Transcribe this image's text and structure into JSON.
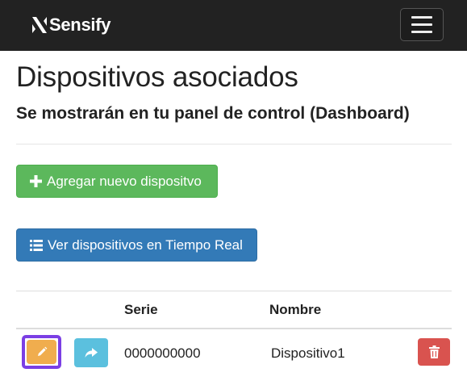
{
  "navbar": {
    "brand_name": "Sensify",
    "menu_toggle_icon": "hamburger-icon"
  },
  "header": {
    "title": "Dispositivos asociados",
    "subtitle": "Se mostrarán en tu panel de control (Dashboard)"
  },
  "actions": {
    "add_label": "Agregar nuevo dispositvo",
    "add_icon": "plus-icon",
    "realtime_label": "Ver dispositivos en Tiempo Real",
    "realtime_icon": "list-icon"
  },
  "table": {
    "columns": [
      "Serie",
      "Nombre"
    ],
    "rows": [
      {
        "serie": "0000000000",
        "nombre": "Dispositivo1",
        "edit_icon": "pencil-icon",
        "share_icon": "share-arrow-icon",
        "delete_icon": "trash-icon"
      }
    ]
  },
  "colors": {
    "navbar": "#222222",
    "add_button": "#5cb85c",
    "realtime_button": "#337ab7",
    "edit_button": "#f0ad4e",
    "share_button": "#5bc0de",
    "delete_button": "#d9534f",
    "focus_outline": "#7b3fe4"
  }
}
